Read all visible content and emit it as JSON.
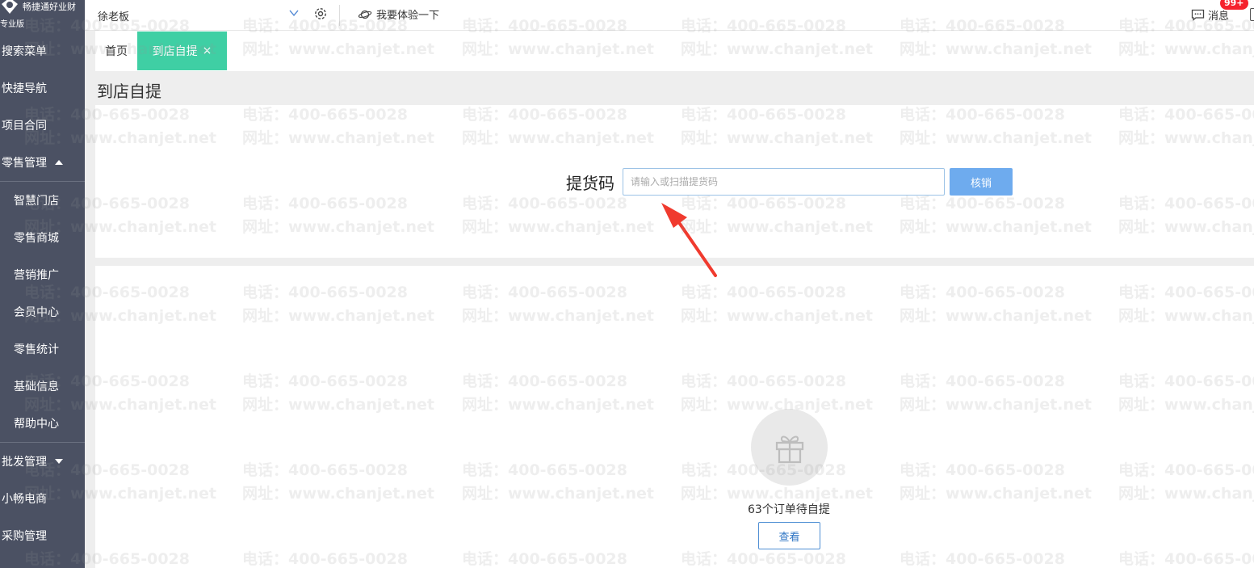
{
  "brand": {
    "name": "畅捷通好业财",
    "edition": "专业版"
  },
  "sidebar": {
    "items": [
      {
        "label": "搜索菜单"
      },
      {
        "label": "快捷导航"
      },
      {
        "label": "项目合同"
      },
      {
        "label": "零售管理",
        "expanded": true
      },
      {
        "label": "智慧门店",
        "sub": true
      },
      {
        "label": "零售商城",
        "sub": true
      },
      {
        "label": "营销推广",
        "sub": true
      },
      {
        "label": "会员中心",
        "sub": true
      },
      {
        "label": "零售统计",
        "sub": true
      },
      {
        "label": "基础信息",
        "sub": true
      },
      {
        "label": "帮助中心",
        "sub": true
      },
      {
        "label": "批发管理",
        "expanded": false
      },
      {
        "label": "小畅电商"
      },
      {
        "label": "采购管理"
      }
    ]
  },
  "topbar": {
    "tenant": "徐老板",
    "experience": "我要体验一下",
    "messages_label": "消息",
    "messages_badge": "99+"
  },
  "tabs": {
    "home": "首页",
    "active": "到店自提",
    "close_glyph": "×"
  },
  "page": {
    "title": "到店自提",
    "pickup_label": "提货码",
    "pickup_placeholder": "请输入或扫描提货码",
    "verify_button": "核销",
    "pending_text": "63个订单待自提",
    "view_button": "查看"
  },
  "watermark": {
    "phone": "电话：400-665-0028",
    "site": "网址：www.chanjet.net"
  },
  "colors": {
    "sidebar_bg": "#4b5163",
    "tab_active_bg": "#3fcfa4",
    "verify_bg": "#6eabee",
    "badge_bg": "#f5222d",
    "arrow": "#f03a2e"
  },
  "icons": {
    "logo": "brand-logo-icon",
    "chevron": "chevron-down-icon",
    "gear": "gear-icon",
    "planet": "planet-icon",
    "message": "message-icon",
    "gift": "gift-icon"
  }
}
